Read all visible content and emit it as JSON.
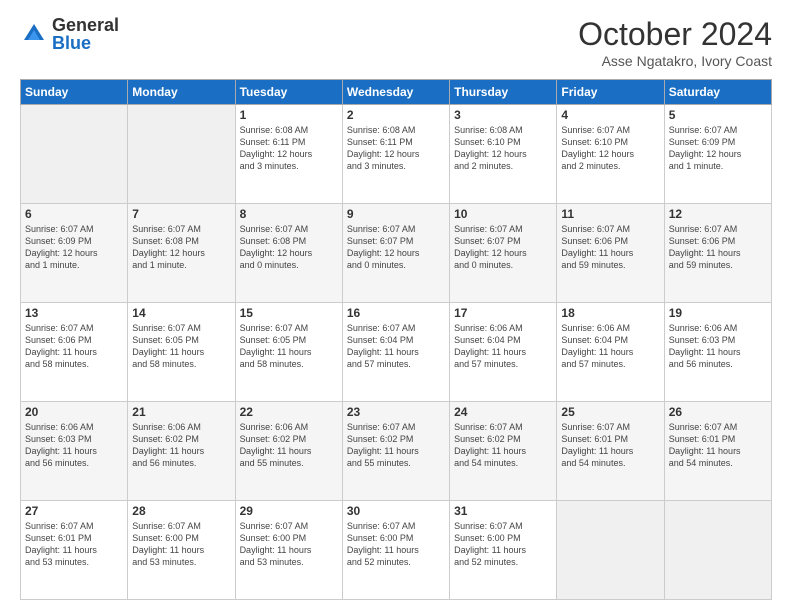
{
  "logo": {
    "general": "General",
    "blue": "Blue"
  },
  "title": "October 2024",
  "subtitle": "Asse Ngatakro, Ivory Coast",
  "days_of_week": [
    "Sunday",
    "Monday",
    "Tuesday",
    "Wednesday",
    "Thursday",
    "Friday",
    "Saturday"
  ],
  "weeks": [
    [
      {
        "day": "",
        "info": ""
      },
      {
        "day": "",
        "info": ""
      },
      {
        "day": "1",
        "info": "Sunrise: 6:08 AM\nSunset: 6:11 PM\nDaylight: 12 hours\nand 3 minutes."
      },
      {
        "day": "2",
        "info": "Sunrise: 6:08 AM\nSunset: 6:11 PM\nDaylight: 12 hours\nand 3 minutes."
      },
      {
        "day": "3",
        "info": "Sunrise: 6:08 AM\nSunset: 6:10 PM\nDaylight: 12 hours\nand 2 minutes."
      },
      {
        "day": "4",
        "info": "Sunrise: 6:07 AM\nSunset: 6:10 PM\nDaylight: 12 hours\nand 2 minutes."
      },
      {
        "day": "5",
        "info": "Sunrise: 6:07 AM\nSunset: 6:09 PM\nDaylight: 12 hours\nand 1 minute."
      }
    ],
    [
      {
        "day": "6",
        "info": "Sunrise: 6:07 AM\nSunset: 6:09 PM\nDaylight: 12 hours\nand 1 minute."
      },
      {
        "day": "7",
        "info": "Sunrise: 6:07 AM\nSunset: 6:08 PM\nDaylight: 12 hours\nand 1 minute."
      },
      {
        "day": "8",
        "info": "Sunrise: 6:07 AM\nSunset: 6:08 PM\nDaylight: 12 hours\nand 0 minutes."
      },
      {
        "day": "9",
        "info": "Sunrise: 6:07 AM\nSunset: 6:07 PM\nDaylight: 12 hours\nand 0 minutes."
      },
      {
        "day": "10",
        "info": "Sunrise: 6:07 AM\nSunset: 6:07 PM\nDaylight: 12 hours\nand 0 minutes."
      },
      {
        "day": "11",
        "info": "Sunrise: 6:07 AM\nSunset: 6:06 PM\nDaylight: 11 hours\nand 59 minutes."
      },
      {
        "day": "12",
        "info": "Sunrise: 6:07 AM\nSunset: 6:06 PM\nDaylight: 11 hours\nand 59 minutes."
      }
    ],
    [
      {
        "day": "13",
        "info": "Sunrise: 6:07 AM\nSunset: 6:06 PM\nDaylight: 11 hours\nand 58 minutes."
      },
      {
        "day": "14",
        "info": "Sunrise: 6:07 AM\nSunset: 6:05 PM\nDaylight: 11 hours\nand 58 minutes."
      },
      {
        "day": "15",
        "info": "Sunrise: 6:07 AM\nSunset: 6:05 PM\nDaylight: 11 hours\nand 58 minutes."
      },
      {
        "day": "16",
        "info": "Sunrise: 6:07 AM\nSunset: 6:04 PM\nDaylight: 11 hours\nand 57 minutes."
      },
      {
        "day": "17",
        "info": "Sunrise: 6:06 AM\nSunset: 6:04 PM\nDaylight: 11 hours\nand 57 minutes."
      },
      {
        "day": "18",
        "info": "Sunrise: 6:06 AM\nSunset: 6:04 PM\nDaylight: 11 hours\nand 57 minutes."
      },
      {
        "day": "19",
        "info": "Sunrise: 6:06 AM\nSunset: 6:03 PM\nDaylight: 11 hours\nand 56 minutes."
      }
    ],
    [
      {
        "day": "20",
        "info": "Sunrise: 6:06 AM\nSunset: 6:03 PM\nDaylight: 11 hours\nand 56 minutes."
      },
      {
        "day": "21",
        "info": "Sunrise: 6:06 AM\nSunset: 6:02 PM\nDaylight: 11 hours\nand 56 minutes."
      },
      {
        "day": "22",
        "info": "Sunrise: 6:06 AM\nSunset: 6:02 PM\nDaylight: 11 hours\nand 55 minutes."
      },
      {
        "day": "23",
        "info": "Sunrise: 6:07 AM\nSunset: 6:02 PM\nDaylight: 11 hours\nand 55 minutes."
      },
      {
        "day": "24",
        "info": "Sunrise: 6:07 AM\nSunset: 6:02 PM\nDaylight: 11 hours\nand 54 minutes."
      },
      {
        "day": "25",
        "info": "Sunrise: 6:07 AM\nSunset: 6:01 PM\nDaylight: 11 hours\nand 54 minutes."
      },
      {
        "day": "26",
        "info": "Sunrise: 6:07 AM\nSunset: 6:01 PM\nDaylight: 11 hours\nand 54 minutes."
      }
    ],
    [
      {
        "day": "27",
        "info": "Sunrise: 6:07 AM\nSunset: 6:01 PM\nDaylight: 11 hours\nand 53 minutes."
      },
      {
        "day": "28",
        "info": "Sunrise: 6:07 AM\nSunset: 6:00 PM\nDaylight: 11 hours\nand 53 minutes."
      },
      {
        "day": "29",
        "info": "Sunrise: 6:07 AM\nSunset: 6:00 PM\nDaylight: 11 hours\nand 53 minutes."
      },
      {
        "day": "30",
        "info": "Sunrise: 6:07 AM\nSunset: 6:00 PM\nDaylight: 11 hours\nand 52 minutes."
      },
      {
        "day": "31",
        "info": "Sunrise: 6:07 AM\nSunset: 6:00 PM\nDaylight: 11 hours\nand 52 minutes."
      },
      {
        "day": "",
        "info": ""
      },
      {
        "day": "",
        "info": ""
      }
    ]
  ]
}
